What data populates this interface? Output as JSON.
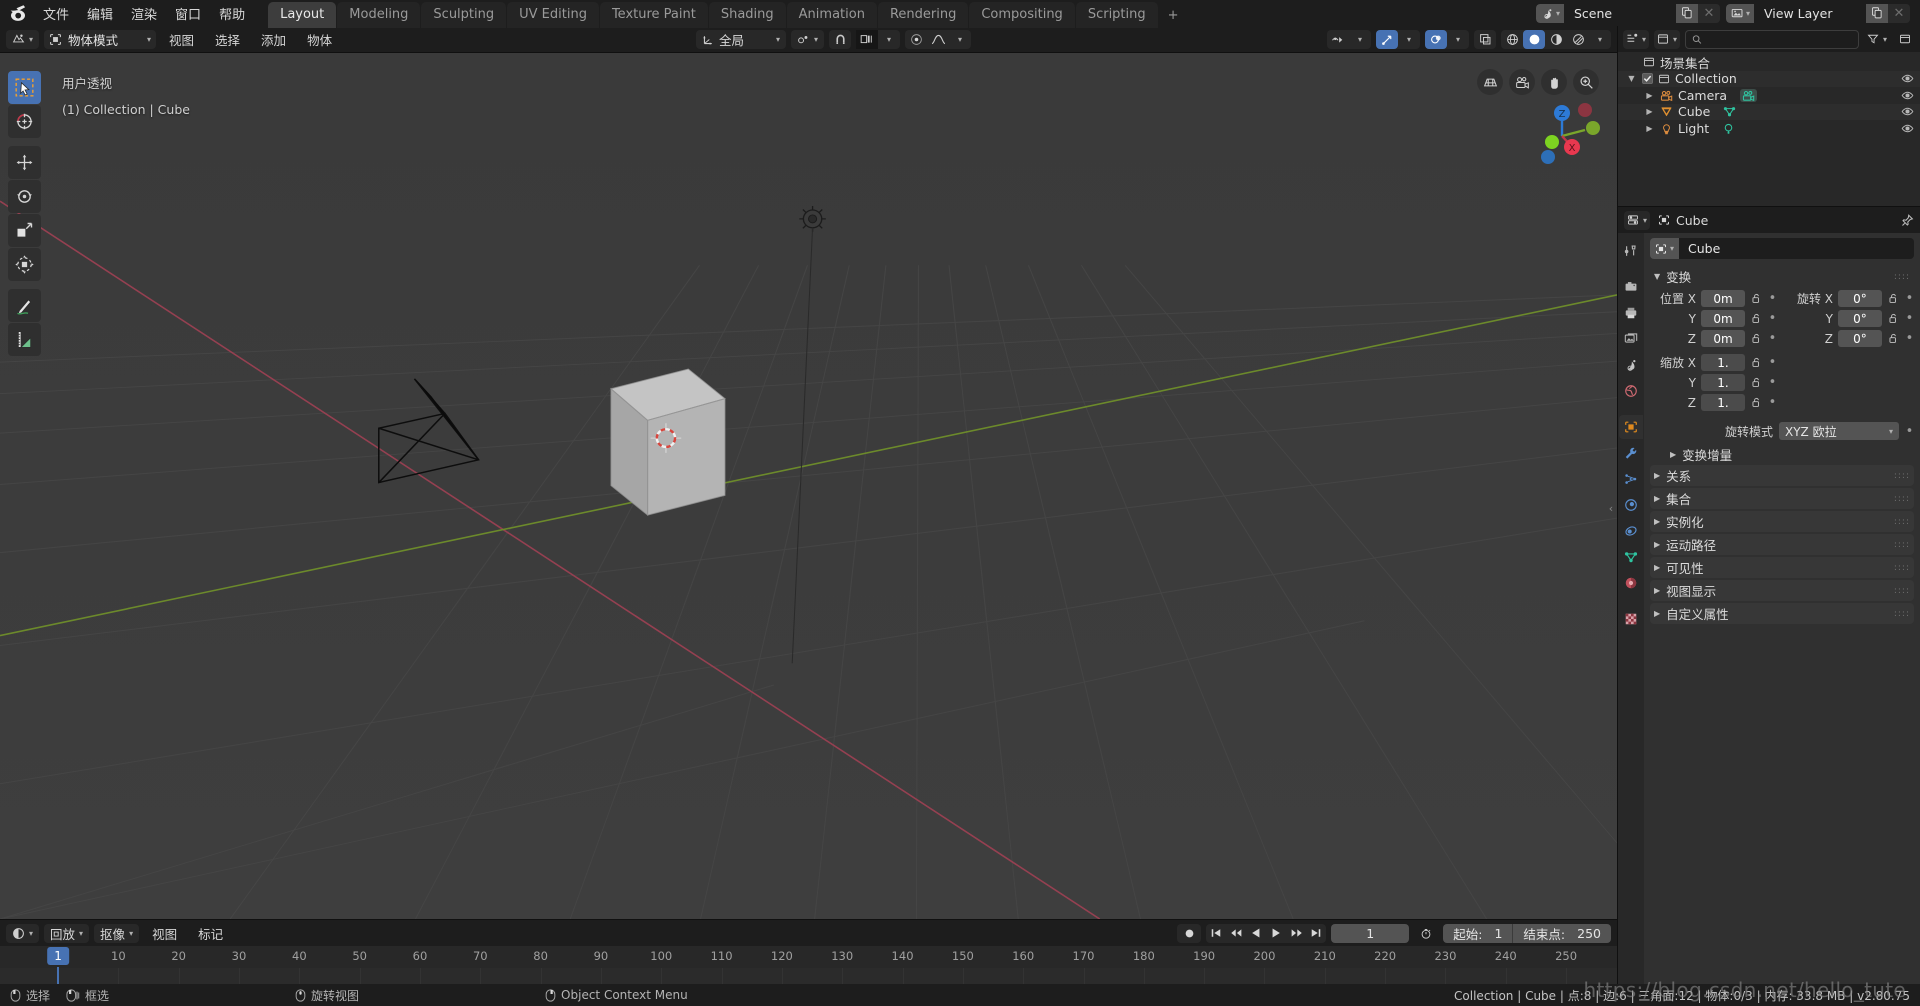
{
  "app": {
    "logo": "blender-logo",
    "menus": [
      "文件",
      "编辑",
      "渲染",
      "窗口",
      "帮助"
    ],
    "workspaces": [
      {
        "label": "Layout",
        "active": true
      },
      {
        "label": "Modeling",
        "active": false
      },
      {
        "label": "Sculpting",
        "active": false
      },
      {
        "label": "UV Editing",
        "active": false
      },
      {
        "label": "Texture Paint",
        "active": false
      },
      {
        "label": "Shading",
        "active": false
      },
      {
        "label": "Animation",
        "active": false
      },
      {
        "label": "Rendering",
        "active": false
      },
      {
        "label": "Compositing",
        "active": false
      },
      {
        "label": "Scripting",
        "active": false
      }
    ],
    "add_workspace": "+",
    "scene": {
      "icon": "scene-icon",
      "name": "Scene",
      "new_btn": "new-scene-icon",
      "unlink_btn": "×"
    },
    "view_layer": {
      "icon": "viewlayer-icon",
      "name": "View Layer",
      "new_btn": "new-viewlayer-icon",
      "unlink_btn": "×"
    }
  },
  "viewport": {
    "header": {
      "editor_type": "editor-type-3dview",
      "mode": "物体模式",
      "menus": [
        "视图",
        "选择",
        "添加",
        "物体"
      ],
      "transform_orientation": "全局",
      "snap_icon": "snap-magnet-icon",
      "proportional_icon": "proportional-editing-icon",
      "falloff_icon": "smooth-falloff-icon",
      "visibility_icon": "object-types-visibility-icon",
      "gizmo_icon": "gizmo-icon",
      "overlays_icon": "overlays-icon",
      "xray_icon": "xray-icon",
      "shading_modes": [
        "wireframe",
        "solid",
        "material-preview",
        "rendered"
      ],
      "shading_active": "solid"
    },
    "overlay_line1": "用户透视",
    "overlay_line2": "(1) Collection | Cube",
    "toolbar": [
      {
        "name": "tweak-select-box-tool",
        "active": true
      },
      {
        "name": "cursor-tool",
        "active": false
      },
      {
        "name": "move-tool",
        "active": false
      },
      {
        "name": "rotate-tool",
        "active": false
      },
      {
        "name": "scale-tool",
        "active": false
      },
      {
        "name": "transform-tool",
        "active": false
      },
      {
        "name": "annotate-tool",
        "active": false
      },
      {
        "name": "measure-tool",
        "active": false
      }
    ],
    "nav_gizmos": [
      "toggle-perspective-ortho-icon",
      "camera-view-icon",
      "pan-view-icon",
      "zoom-view-icon"
    ],
    "axis_gizmo": {
      "x": "X",
      "y": "Y",
      "z": "Z"
    }
  },
  "timeline": {
    "editor_icon": "editor-type-timeline",
    "menus": [
      "回放",
      "抠像",
      "视图",
      "标记"
    ],
    "record_icon": "auto-keying-icon",
    "transport": [
      "jump-start-icon",
      "prev-keyframe-icon",
      "play-reverse-icon",
      "play-icon",
      "next-keyframe-icon",
      "jump-end-icon"
    ],
    "current_frame": "1",
    "use_preview_range_icon": "stopwatch-icon",
    "start_label": "起始:",
    "start_value": "1",
    "end_label": "结束点:",
    "end_value": "250",
    "ticks": [
      "1",
      "10",
      "20",
      "30",
      "40",
      "50",
      "60",
      "70",
      "80",
      "90",
      "100",
      "110",
      "120",
      "130",
      "140",
      "150",
      "160",
      "170",
      "180",
      "190",
      "200",
      "210",
      "220",
      "230",
      "240",
      "250"
    ],
    "playhead_label": "1"
  },
  "outliner": {
    "editor_icon": "editor-type-outliner",
    "display_mode_icon": "display-mode-view-layer",
    "search_placeholder": "",
    "filter_icon": "filter-icon",
    "new_collection_icon": "new-collection-icon",
    "root": "场景集合",
    "rows": [
      {
        "label": "Collection",
        "level": 1,
        "icon": "collection-icon",
        "checkbox": true,
        "expand": "▼",
        "eye": true,
        "extra_icon": null
      },
      {
        "label": "Camera",
        "level": 2,
        "icon": "camera-object-icon",
        "checkbox": false,
        "expand": "▶",
        "eye": true,
        "extra_icon": "camera-data-icon"
      },
      {
        "label": "Cube",
        "level": 2,
        "icon": "mesh-object-icon",
        "checkbox": false,
        "expand": "▶",
        "eye": true,
        "extra_icon": "mesh-data-icon"
      },
      {
        "label": "Light",
        "level": 2,
        "icon": "light-object-icon",
        "checkbox": false,
        "expand": "▶",
        "eye": true,
        "extra_icon": "light-data-icon"
      }
    ]
  },
  "properties": {
    "editor_icon": "editor-type-properties",
    "breadcrumb_icon": "object-icon",
    "breadcrumb": "Cube",
    "pin_icon": "pin-icon",
    "tabs": [
      {
        "name": "tool-tab",
        "active": false
      },
      {
        "name": "render-tab",
        "active": false
      },
      {
        "name": "output-tab",
        "active": false
      },
      {
        "name": "view-layer-tab",
        "active": false
      },
      {
        "name": "scene-tab",
        "active": false
      },
      {
        "name": "world-tab",
        "active": false
      },
      {
        "name": "object-tab",
        "active": true
      },
      {
        "name": "modifier-tab",
        "active": false
      },
      {
        "name": "particles-tab",
        "active": false
      },
      {
        "name": "physics-tab",
        "active": false
      },
      {
        "name": "constraints-tab",
        "active": false
      },
      {
        "name": "object-data-tab",
        "active": false
      },
      {
        "name": "material-tab",
        "active": false
      },
      {
        "name": "texture-tab",
        "active": false
      }
    ],
    "id_name": "Cube",
    "transform_panel": "变换",
    "location_label": "位置 X",
    "rotation_label": "旋转 X",
    "scale_label": "缩放 X",
    "axis_y": "Y",
    "axis_z": "Z",
    "location": [
      "0m",
      "0m",
      "0m"
    ],
    "rotation": [
      "0°",
      "0°",
      "0°"
    ],
    "scale": [
      "1.",
      "1.",
      "1."
    ],
    "rotation_mode_label": "旋转模式",
    "rotation_mode_value": "XYZ 欧拉",
    "delta_transform_panel": "变换增量",
    "panels": [
      "关系",
      "集合",
      "实例化",
      "运动路径",
      "可见性",
      "视图显示",
      "自定义属性"
    ]
  },
  "statusbar": {
    "items": [
      {
        "icon": "mouse-left-icon",
        "label": "选择"
      },
      {
        "icon": "mouse-left-drag-icon",
        "label": "框选"
      },
      {
        "icon": "mouse-middle-icon",
        "label": "旋转视图"
      },
      {
        "icon": "mouse-right-icon",
        "label": "Object Context Menu"
      }
    ],
    "info": "Collection | Cube | 点:8 | 边:6 | 三角面:12 | 物体:0/3 | 内存: 33.8 MB | v2.80.75",
    "watermark": "https://blog.csdn.net/hello_tute"
  },
  "colors": {
    "accent": "#4772b3",
    "orange": "#e08a1e",
    "viewport_bg": "#3b3b3b",
    "panel_bg": "#303030",
    "header_bg": "#1d1d1d",
    "x_axis": "#c0384a",
    "y_axis": "#7aa62b",
    "z_axis": "#2d7ad6"
  }
}
